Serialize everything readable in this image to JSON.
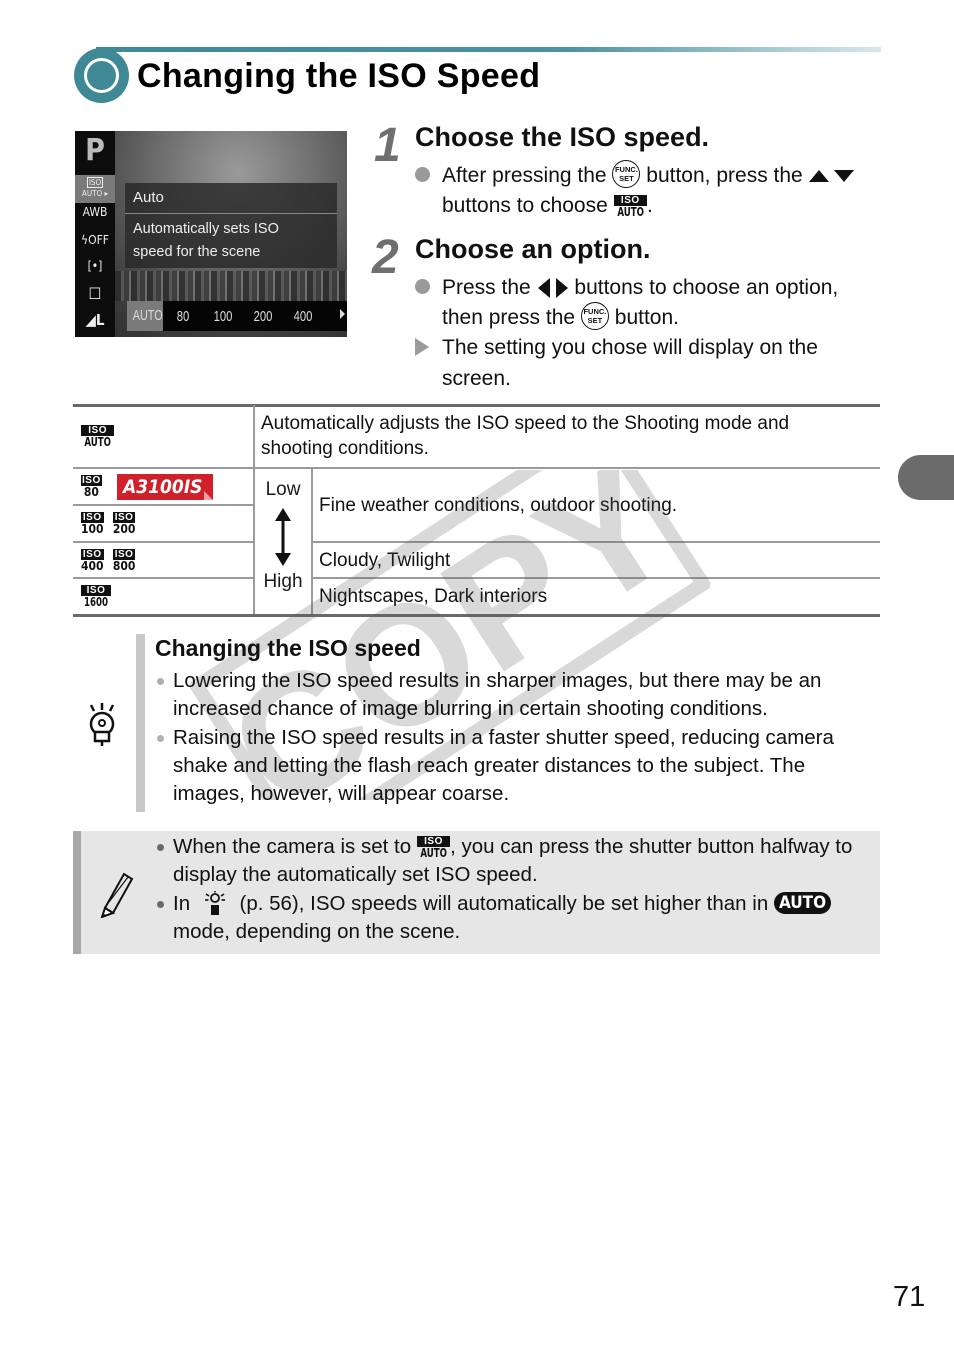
{
  "header": {
    "title": "Changing the ISO Speed",
    "accent_color": "#3f8896"
  },
  "lcd": {
    "mode": "P",
    "side_items": [
      "ISO AUTO",
      "AWB",
      "OFF",
      "metering",
      "drive",
      "L"
    ],
    "panel_title": "Auto",
    "panel_desc_line1": "Automatically sets ISO",
    "panel_desc_line2": "speed for the scene",
    "options": [
      "AUTO",
      "80",
      "100",
      "200",
      "400"
    ],
    "selected_option": "AUTO"
  },
  "steps": [
    {
      "number": "1",
      "title": "Choose the ISO speed.",
      "line1_a": "After pressing the",
      "line1_b": "button, press the",
      "line2_a": "buttons to choose",
      "line2_b": "."
    },
    {
      "number": "2",
      "title": "Choose an option.",
      "line1_a": "Press the",
      "line1_b": "buttons to choose an option,",
      "line2_a": "then press the",
      "line2_b": "button.",
      "result_line1": "The setting you chose will display on the",
      "result_line2": "screen."
    }
  ],
  "icons": {
    "func_top": "FUNC.",
    "func_bottom": "SET",
    "iso_label": "ISO",
    "iso_auto": "AUTO"
  },
  "table": {
    "auto_row": {
      "icon_value": "AUTO",
      "description_line1": "Automatically adjusts the ISO speed to the Shooting mode and",
      "description_line2": "shooting conditions."
    },
    "rows": [
      {
        "icons": [
          "80"
        ],
        "badge": "A3100IS"
      },
      {
        "icons": [
          "100",
          "200"
        ]
      },
      {
        "icons": [
          "400",
          "800"
        ]
      },
      {
        "icons": [
          "1600"
        ]
      }
    ],
    "scale_low": "Low",
    "scale_high": "High",
    "descriptions": [
      "Fine weather conditions, outdoor shooting.",
      "Cloudy, Twilight",
      "Nightscapes, Dark interiors"
    ],
    "badge_color": "#d0202a"
  },
  "tip": {
    "title": "Changing the ISO speed",
    "items": [
      "Lowering the ISO speed results in sharper images, but there may be an increased chance of image blurring in certain shooting conditions.",
      "Raising the ISO speed results in a faster shutter speed, reducing camera shake and letting the flash reach greater distances to the subject. The images, however, will appear coarse."
    ]
  },
  "note": {
    "item1_a": "When the camera is set to",
    "item1_b": ", you can press the shutter button halfway to display the automatically set ISO speed.",
    "item2_a": "In",
    "item2_b": "(p. 56), ISO speeds will automatically be set higher than in",
    "item2_c": "mode, depending on the scene.",
    "auto_mode_label": "AUTO"
  },
  "watermark": "COPY",
  "page_number": "71"
}
